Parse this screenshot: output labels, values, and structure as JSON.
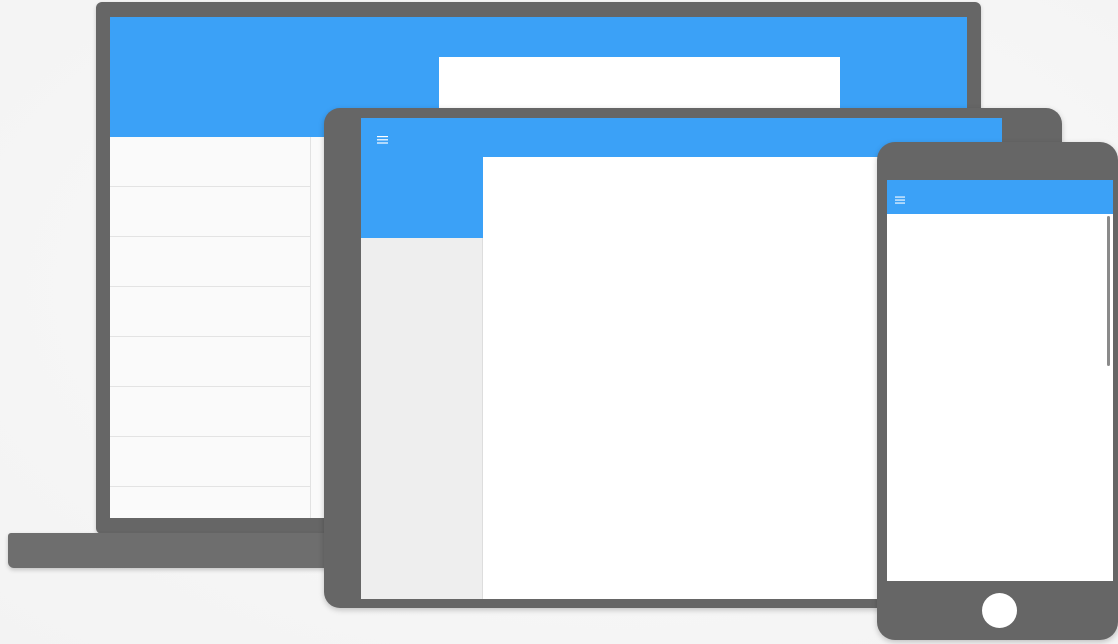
{
  "colors": {
    "device_frame": "#666666",
    "app_bar": "#3ba1f7",
    "surface": "#ffffff",
    "list_background": "#fafafa",
    "drawer_background": "#eeeeee",
    "background": "#f7f7f7"
  },
  "laptop": {
    "list_rows": 8
  },
  "tablet": {
    "menu_icon": "hamburger-menu-icon"
  },
  "phone": {
    "menu_icon": "hamburger-menu-icon",
    "home_button_icon": "circle-home-button"
  }
}
